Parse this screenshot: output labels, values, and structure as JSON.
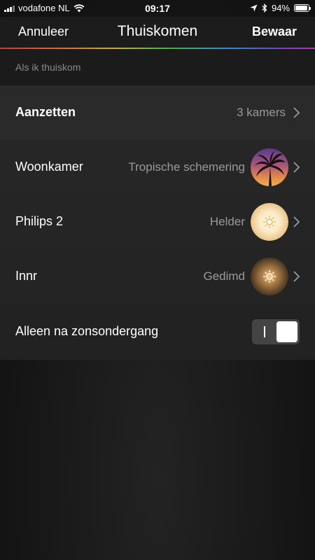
{
  "status_bar": {
    "carrier": "vodafone NL",
    "time": "09:17",
    "battery_percent": "94%",
    "battery_level": 0.94
  },
  "nav": {
    "cancel_label": "Annuleer",
    "title": "Thuiskomen",
    "save_label": "Bewaar"
  },
  "section": {
    "header": "Als ik thuiskom"
  },
  "rows": {
    "turn_on": {
      "label": "Aanzetten",
      "value": "3 kamers"
    },
    "rooms": [
      {
        "label": "Woonkamer",
        "value": "Tropische schemering",
        "icon": "palm-sunset-thumbnail"
      },
      {
        "label": "Philips 2",
        "value": "Helder",
        "icon": "bright-sun-thumbnail"
      },
      {
        "label": "Innr",
        "value": "Gedimd",
        "icon": "dimmed-sun-thumbnail"
      }
    ],
    "sunset_only": {
      "label": "Alleen na zonsondergang",
      "enabled": true
    }
  },
  "colors": {
    "background": "#141414",
    "row_text": "#ffffff",
    "value_text": "#9a9a9a",
    "header_text": "#8a8a8a"
  }
}
